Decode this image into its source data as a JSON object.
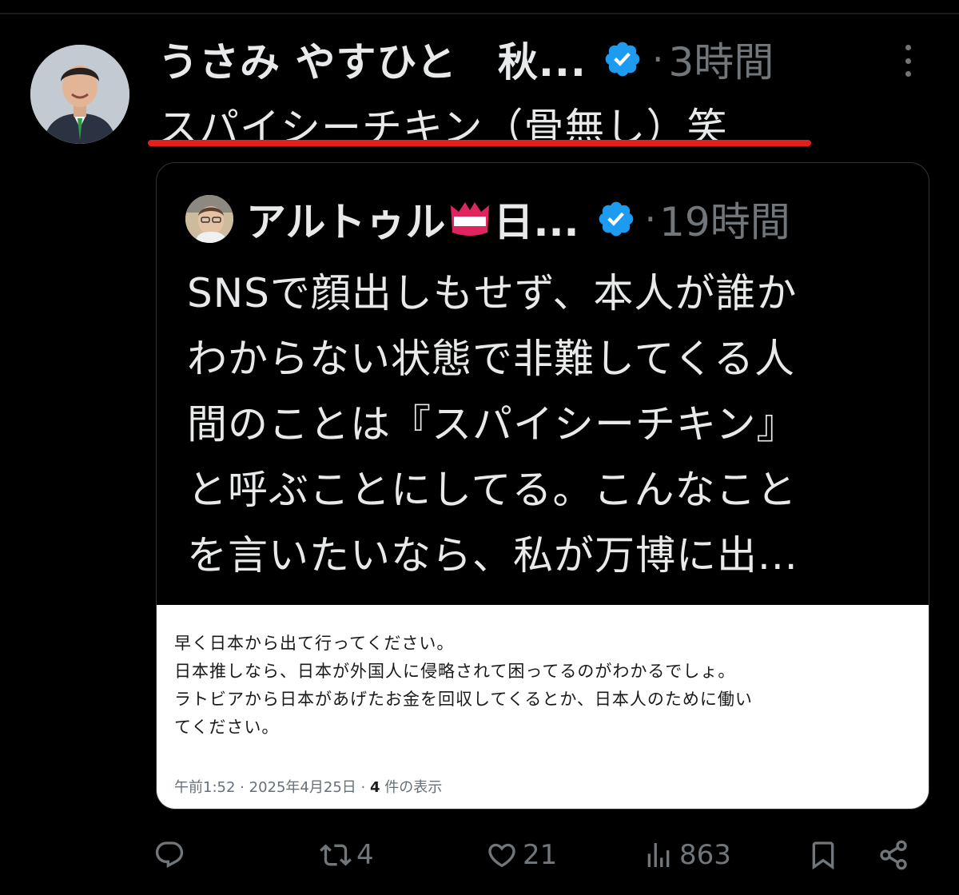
{
  "author": {
    "display_name": "うさみ やすひと　秋...",
    "verified": true,
    "separator": "·",
    "time_ago": "3時間"
  },
  "tweet": {
    "text": "スパイシーチキン（骨無し）笑",
    "highlight_color": "#e21f1f"
  },
  "quoted_tweet": {
    "display_name_part1": "アルトゥル",
    "display_name_part2": "日...",
    "verified": true,
    "separator": "·",
    "time_ago": "19時間",
    "body_lines": [
      "SNSで顔出しもせず、本人が誰か",
      "わからない状態で非難してくる人",
      "間のことは『スパイシーチキン』",
      "と呼ぶことにしてる。こんなこと",
      "を言いたいなら、私が万博に出..."
    ],
    "image_text_lines": [
      "早く日本から出て行ってください。",
      "日本推しなら、日本が外国人に侵略されて困ってるのがわかるでしょ。",
      "ラトビアから日本があげたお金を回収してくるとか、日本人のために働い",
      "てください。"
    ],
    "image_meta": {
      "time": "午前1:52",
      "sep1": "·",
      "date": "2025年4月25日",
      "sep2": "·",
      "view_count": "4",
      "view_label": "件の表示"
    }
  },
  "actions": {
    "reply_count": "",
    "retweet_count": "4",
    "like_count": "21",
    "view_count": "863"
  },
  "colors": {
    "background": "#000000",
    "text_primary": "#e7e9ea",
    "text_secondary": "#71767b",
    "verified_blue": "#1d9bf0"
  }
}
